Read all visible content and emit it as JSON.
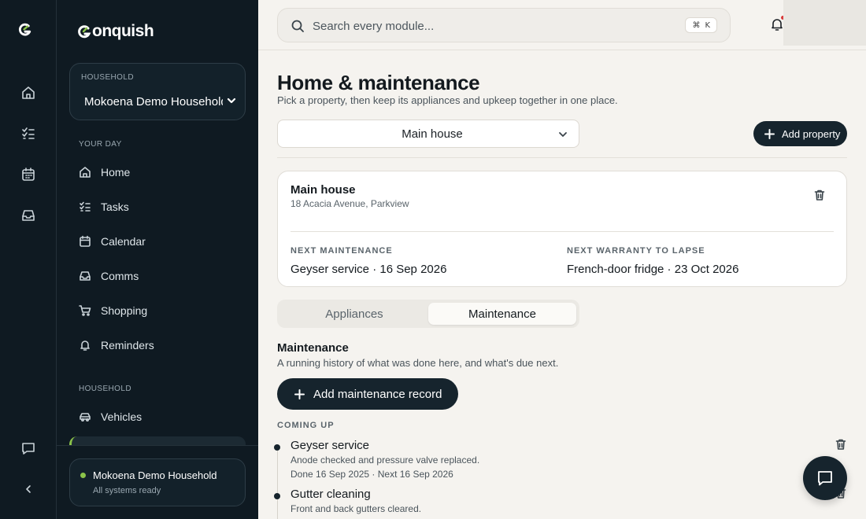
{
  "brand": {
    "name": "onquish"
  },
  "rail": {
    "icons": [
      "home-icon",
      "tasks-icon",
      "calendar-icon",
      "inbox-icon",
      "chat-icon",
      "collapse-icon"
    ]
  },
  "sidebar": {
    "household_label": "HOUSEHOLD",
    "household_value": "Mokoena Demo Household",
    "section_your_day": "YOUR DAY",
    "section_household": "HOUSEHOLD",
    "items": [
      {
        "label": "Home",
        "icon": "home-icon"
      },
      {
        "label": "Tasks",
        "icon": "tasks-icon"
      },
      {
        "label": "Calendar",
        "icon": "calendar-icon"
      },
      {
        "label": "Comms",
        "icon": "comms-icon"
      },
      {
        "label": "Shopping",
        "icon": "cart-icon"
      },
      {
        "label": "Reminders",
        "icon": "bell-icon"
      },
      {
        "label": "Vehicles",
        "icon": "car-icon"
      }
    ],
    "status": {
      "name": "Mokoena Demo Household",
      "text": "All systems ready"
    }
  },
  "topbar": {
    "search_placeholder": "Search every module...",
    "shortcut_cmd": "⌘",
    "shortcut_key": "K"
  },
  "page": {
    "title": "Home & maintenance",
    "subtitle": "Pick a property, then keep its appliances and upkeep together in one place.",
    "selected_property": "Main house",
    "add_property_label": "Add property"
  },
  "property": {
    "name": "Main house",
    "address": "18 Acacia Avenue, Parkview",
    "next_maintenance_label": "NEXT MAINTENANCE",
    "next_maintenance_value": "Geyser service · 16 Sep 2026",
    "next_warranty_label": "NEXT WARRANTY TO LAPSE",
    "next_warranty_value": "French-door fridge · 23 Oct 2026"
  },
  "tabs": {
    "appliances": "Appliances",
    "maintenance": "Maintenance",
    "active": "Maintenance"
  },
  "maintenance": {
    "heading": "Maintenance",
    "subheading": "A running history of what was done here, and what's due next.",
    "add_label": "Add maintenance record",
    "coming_up_label": "COMING UP",
    "records": [
      {
        "title": "Geyser service",
        "desc": "Anode checked and pressure valve replaced.",
        "dates": "Done 16 Sep 2025 · Next 16 Sep 2026"
      },
      {
        "title": "Gutter cleaning",
        "desc": "Front and back gutters cleared."
      }
    ]
  },
  "colors": {
    "sidebar_bg": "#0f1a22",
    "accent_green": "#8bc34a",
    "button_dark": "#16242d",
    "notification_red": "#d93a3a"
  }
}
